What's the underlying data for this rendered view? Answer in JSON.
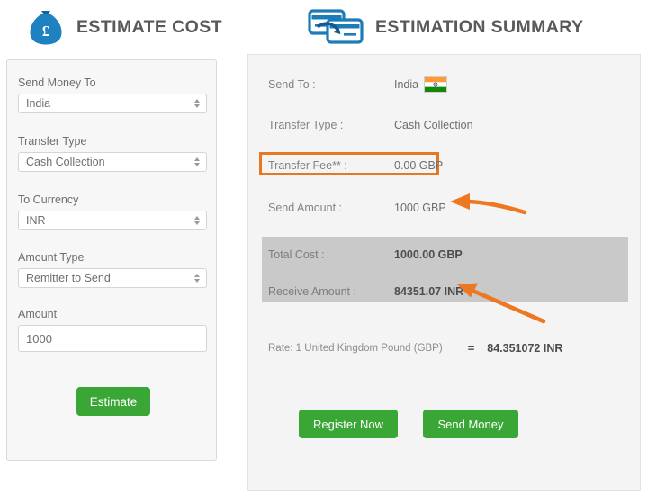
{
  "headers": {
    "left": {
      "title": "ESTIMATE COST",
      "icon": "money-bag-gbp-icon"
    },
    "right": {
      "title": "ESTIMATION SUMMARY",
      "icon": "credit-cards-transfer-icon"
    }
  },
  "form": {
    "fields": [
      {
        "label": "Send Money To",
        "value": "India",
        "type": "select"
      },
      {
        "label": "Transfer Type",
        "value": "Cash Collection",
        "type": "select"
      },
      {
        "label": "To Currency",
        "value": "INR",
        "type": "select"
      },
      {
        "label": "Amount Type",
        "value": "Remitter to Send",
        "type": "select"
      },
      {
        "label": "Amount",
        "value": "1000",
        "type": "text"
      }
    ],
    "estimate_button": "Estimate"
  },
  "summary": {
    "rows": [
      {
        "label": "Send To :",
        "value": "India",
        "flag": "india-flag-icon"
      },
      {
        "label": "Transfer Type :",
        "value": "Cash Collection"
      },
      {
        "label": "Transfer Fee** :",
        "value": "0.00 GBP"
      },
      {
        "label": "Send Amount :",
        "value": "1000 GBP"
      },
      {
        "label": "Total Cost :",
        "value": "1000.00 GBP"
      },
      {
        "label": "Receive Amount :",
        "value": "84351.07 INR"
      }
    ],
    "rate": {
      "text": "Rate: 1 United Kingdom Pound (GBP)",
      "equals": "=",
      "value": "84.351072 INR"
    },
    "register_button": "Register Now",
    "send_money_button": "Send Money"
  },
  "colors": {
    "green_button": "#3aa635",
    "orange_accent": "#e87722",
    "grey_band": "#c9c9c9",
    "icon_blue": "#1c7cb8",
    "title_grey": "#58595b"
  }
}
